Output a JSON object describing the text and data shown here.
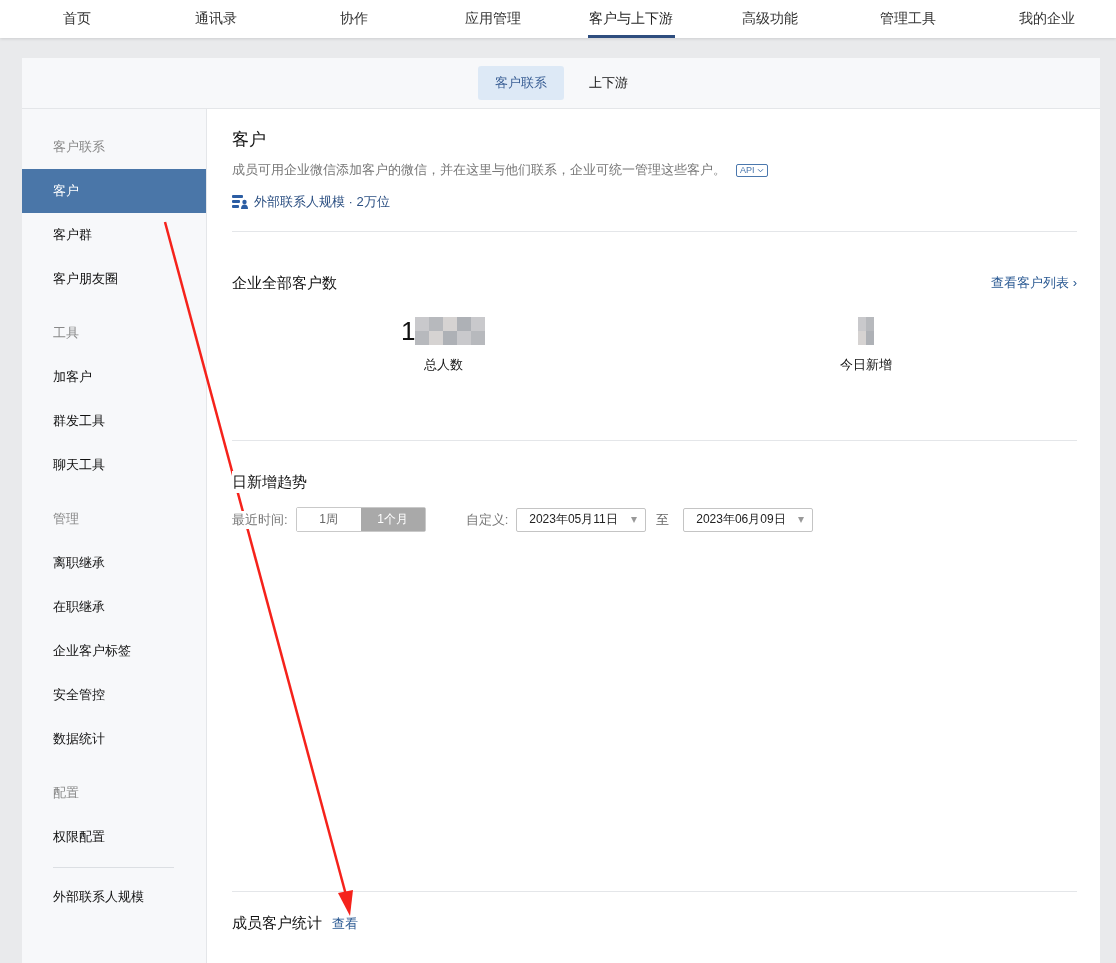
{
  "top_nav": [
    {
      "label": "首页",
      "selected": false
    },
    {
      "label": "通讯录",
      "selected": false
    },
    {
      "label": "协作",
      "selected": false
    },
    {
      "label": "应用管理",
      "selected": false
    },
    {
      "label": "客户与上下游",
      "selected": true
    },
    {
      "label": "高级功能",
      "selected": false
    },
    {
      "label": "管理工具",
      "selected": false
    },
    {
      "label": "我的企业",
      "selected": false
    }
  ],
  "sub_tabs": [
    {
      "label": "客户联系",
      "selected": true
    },
    {
      "label": "上下游",
      "selected": false
    }
  ],
  "sidebar": {
    "groups": [
      {
        "title": "客户联系",
        "items": [
          {
            "label": "客户",
            "selected": true
          },
          {
            "label": "客户群",
            "selected": false
          },
          {
            "label": "客户朋友圈",
            "selected": false
          }
        ]
      },
      {
        "title": "工具",
        "items": [
          {
            "label": "加客户",
            "selected": false
          },
          {
            "label": "群发工具",
            "selected": false
          },
          {
            "label": "聊天工具",
            "selected": false
          }
        ]
      },
      {
        "title": "管理",
        "items": [
          {
            "label": "离职继承",
            "selected": false
          },
          {
            "label": "在职继承",
            "selected": false
          },
          {
            "label": "企业客户标签",
            "selected": false
          },
          {
            "label": "安全管控",
            "selected": false
          },
          {
            "label": "数据统计",
            "selected": false
          }
        ]
      },
      {
        "title": "配置",
        "items": [
          {
            "label": "权限配置",
            "selected": false
          }
        ]
      }
    ],
    "footer_item": "外部联系人规模"
  },
  "header": {
    "title": "客户",
    "description": "成员可用企业微信添加客户的微信，并在这里与他们联系，企业可统一管理这些客户。",
    "api_badge": "API",
    "scale": "外部联系人规模 · 2万位"
  },
  "totals": {
    "title": "企业全部客户数",
    "link": "查看客户列表 ›",
    "stats": [
      {
        "value": "1",
        "label": "总人数",
        "redacted": true
      },
      {
        "label": "今日新增",
        "redacted": true
      }
    ]
  },
  "trend": {
    "title": "日新增趋势",
    "range_label": "最近时间:",
    "ranges": [
      {
        "label": "1周",
        "selected": false
      },
      {
        "label": "1个月",
        "selected": true
      }
    ],
    "custom_label": "自定义:",
    "from": "2023年05月11日",
    "to_label": "至",
    "to": "2023年06月09日"
  },
  "member_stats": {
    "title": "成员客户统计",
    "link": "查看"
  },
  "annotation": {
    "kind": "arrow"
  }
}
